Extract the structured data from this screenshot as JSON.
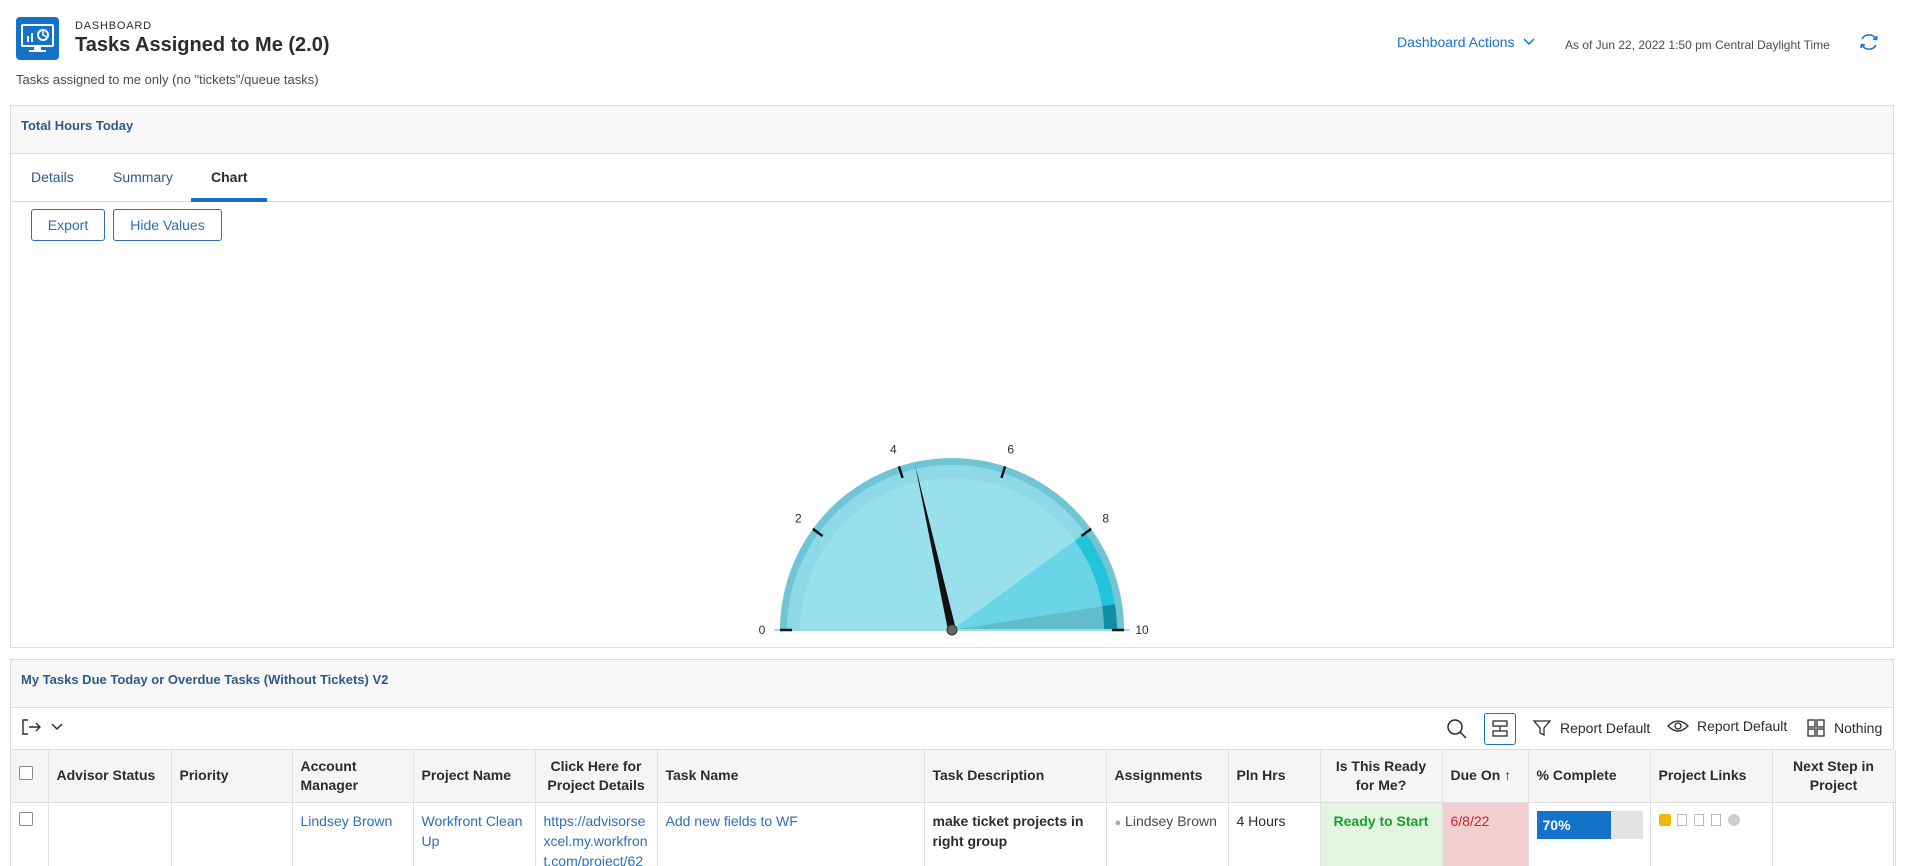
{
  "header": {
    "overline": "DASHBOARD",
    "title": "Tasks Assigned to Me (2.0)",
    "subtitle": "Tasks assigned to me only (no \"tickets\"/queue tasks)",
    "actions_label": "Dashboard Actions",
    "as_of": "As of  Jun 22, 2022 1:50 pm Central Daylight Time"
  },
  "panel1": {
    "title": "Total Hours Today",
    "tabs": [
      "Details",
      "Summary",
      "Chart"
    ],
    "active_tab": "Chart",
    "export_label": "Export",
    "hide_values_label": "Hide Values"
  },
  "chart_data": {
    "type": "gauge",
    "min": 0,
    "max": 10,
    "value": 4.3,
    "tick_labels": [
      "0",
      "2",
      "4",
      "6",
      "8",
      "10"
    ],
    "bands": [
      {
        "from": 0,
        "to": 8,
        "color": "#8dd9e8"
      },
      {
        "from": 8,
        "to": 9.5,
        "color": "#22c4dc"
      },
      {
        "from": 9.5,
        "to": 10,
        "color": "#0e8fa3"
      }
    ]
  },
  "panel2": {
    "title": "My Tasks Due Today or Overdue Tasks (Without Tickets) V2",
    "toolbar": {
      "report_default_1": "Report Default",
      "report_default_2": "Report Default",
      "grouping": "Nothing"
    },
    "columns": [
      "Advisor Status",
      "Priority",
      "Account Manager",
      "Project Name",
      "Click Here for Project Details",
      "Task Name",
      "Task Description",
      "Assignments",
      "Pln Hrs",
      "Is This Ready for Me?",
      "Due On",
      "% Complete",
      "Project Links",
      "Next Step in Project"
    ],
    "rows": [
      {
        "advisor_status": "",
        "priority": "",
        "account_manager": "Lindsey Brown",
        "project_name": "Workfront Clean Up",
        "project_details": "https://advisorsexcel.my.workfront.com/project/62",
        "task_name": "Add new fields to WF",
        "task_description": "make ticket projects in right group",
        "assignments": "Lindsey Brown",
        "pln_hrs": "4 Hours",
        "ready": "Ready to Start",
        "due_on": "6/8/22",
        "pct_complete": "70%",
        "pct_value": 70,
        "next_step": ""
      }
    ]
  },
  "colors": {
    "accent": "#1473c8",
    "ready_bg": "#e3f5e1",
    "due_bg": "#f3cfd1"
  }
}
